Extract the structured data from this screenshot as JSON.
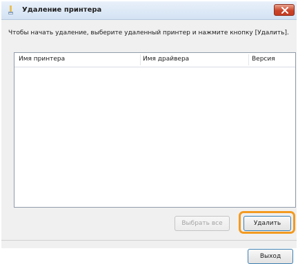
{
  "window": {
    "title": "Удаление принтера"
  },
  "instruction": "Чтобы начать удаление, выберите удаленный принтер и нажмите кнопку [Удалить].",
  "printer_list": {
    "columns": [
      "Имя принтера",
      "Имя драйвера",
      "Версия"
    ],
    "rows": []
  },
  "buttons": {
    "select_all": "Выбрать все",
    "delete": "Удалить",
    "exit": "Выход"
  },
  "colors": {
    "highlight": "#f39a1f",
    "close": "#c9452b"
  }
}
